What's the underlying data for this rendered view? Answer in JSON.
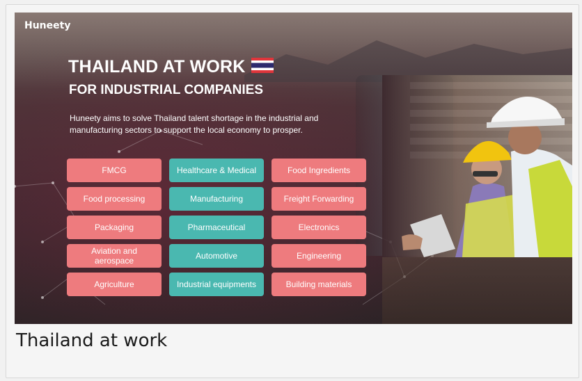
{
  "banner": {
    "logo": "Huneety",
    "headline": "THAILAND AT WORK",
    "flag_icon": "thailand-flag-icon",
    "subheadline": "FOR INDUSTRIAL COMPANIES",
    "description": "Huneety aims to solve Thailand talent shortage in the industrial and manufacturing sectors to support the local economy to prosper.",
    "industries": [
      {
        "label": "FMCG",
        "color": "#ee7b7e"
      },
      {
        "label": "Healthcare & Medical",
        "color": "#4ab8b0"
      },
      {
        "label": "Food Ingredients",
        "color": "#ee7b7e"
      },
      {
        "label": "Food processing",
        "color": "#ee7b7e"
      },
      {
        "label": "Manufacturing",
        "color": "#4ab8b0"
      },
      {
        "label": "Freight Forwarding",
        "color": "#ee7b7e"
      },
      {
        "label": "Packaging",
        "color": "#ee7b7e"
      },
      {
        "label": "Pharmaceutical",
        "color": "#4ab8b0"
      },
      {
        "label": "Electronics",
        "color": "#ee7b7e"
      },
      {
        "label": "Aviation and aerospace",
        "color": "#ee7b7e"
      },
      {
        "label": "Automotive",
        "color": "#4ab8b0"
      },
      {
        "label": "Engineering",
        "color": "#ee7b7e"
      },
      {
        "label": "Agriculture",
        "color": "#ee7b7e"
      },
      {
        "label": "Industrial equipments",
        "color": "#4ab8b0"
      },
      {
        "label": "Building materials",
        "color": "#ee7b7e"
      }
    ]
  },
  "caption": "Thailand at work"
}
